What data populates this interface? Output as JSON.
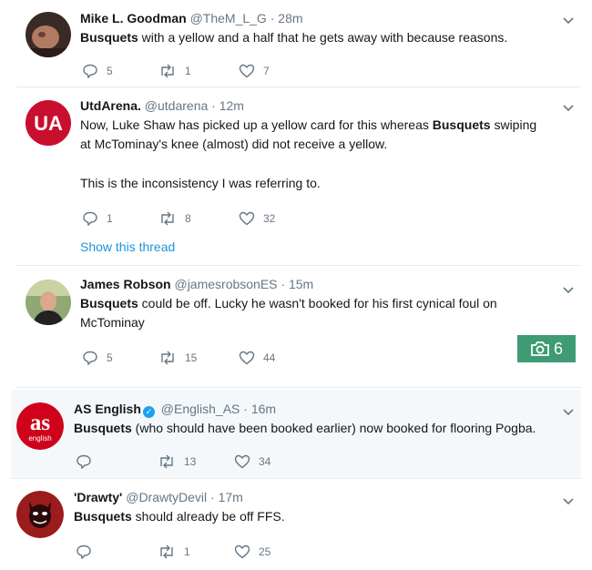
{
  "tweets": [
    {
      "name": "Mike L. Goodman",
      "handle": "@TheM_L_G",
      "dot": "·",
      "time": "28m",
      "text_bold": "Busquets",
      "text_rest": " with a yellow and a half that he gets away with because reasons.",
      "replies": "5",
      "retweets": "1",
      "likes": "7"
    },
    {
      "name": "UtdArena.",
      "handle": "@utdarena",
      "dot": "·",
      "time": "12m",
      "avatar_text": "UA",
      "text_a": "Now, Luke Shaw has picked up a yellow card for this whereas ",
      "text_bold": "Busquets",
      "text_b": " swiping at McTominay's knee (almost) did not receive a yellow.",
      "text_c": "This is the inconsistency I was referring to.",
      "replies": "1",
      "retweets": "8",
      "likes": "32",
      "thread_link": "Show this thread"
    },
    {
      "name": "James Robson",
      "handle": "@jamesrobsonES",
      "dot": "·",
      "time": "15m",
      "text_bold": "Busquets",
      "text_rest": " could be off. Lucky he wasn't booked for his first cynical foul on McTominay",
      "replies": "5",
      "retweets": "15",
      "likes": "44",
      "photo_count": "6"
    },
    {
      "name": "AS English",
      "handle": "@English_AS",
      "dot": "·",
      "time": "16m",
      "avatar_text_main": "as",
      "avatar_text_sub": "english",
      "text_bold": "Busquets",
      "text_rest": " (who should have been booked earlier) now booked for flooring Pogba.",
      "retweets": "13",
      "likes": "34"
    },
    {
      "name": "'Drawty'",
      "handle": "@DrawtyDevil",
      "dot": "·",
      "time": "17m",
      "text_bold": "Busquets",
      "text_rest": " should already be off FFS.",
      "retweets": "1",
      "likes": "25"
    }
  ],
  "colors": {
    "brand_blue": "#1da1f2",
    "link": "#1b95e0",
    "muted": "#657786",
    "utdarena_red": "#c8102e",
    "as_red": "#d0021b",
    "photo_badge": "#3f9b74"
  }
}
